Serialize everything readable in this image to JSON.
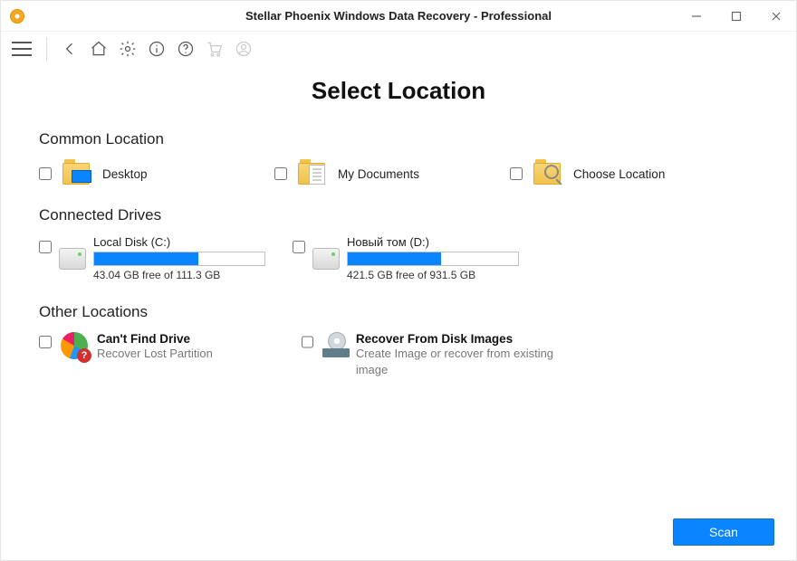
{
  "title": "Stellar Phoenix Windows Data Recovery - Professional",
  "page_heading": "Select Location",
  "sections": {
    "common": {
      "title": "Common Location",
      "items": [
        {
          "label": "Desktop"
        },
        {
          "label": "My Documents"
        },
        {
          "label": "Choose Location"
        }
      ]
    },
    "drives": {
      "title": "Connected Drives",
      "items": [
        {
          "name": "Local Disk (C:)",
          "free_text": "43.04 GB free of 111.3 GB",
          "used_percent": 61
        },
        {
          "name": "Новый том (D:)",
          "free_text": "421.5 GB free of 931.5 GB",
          "used_percent": 55
        }
      ]
    },
    "other": {
      "title": "Other Locations",
      "items": [
        {
          "title": "Can't Find Drive",
          "subtitle": "Recover Lost Partition"
        },
        {
          "title": "Recover From Disk Images",
          "subtitle": "Create Image or recover from existing image"
        }
      ]
    }
  },
  "footer": {
    "scan_label": "Scan"
  },
  "colors": {
    "accent": "#0a84ff"
  }
}
